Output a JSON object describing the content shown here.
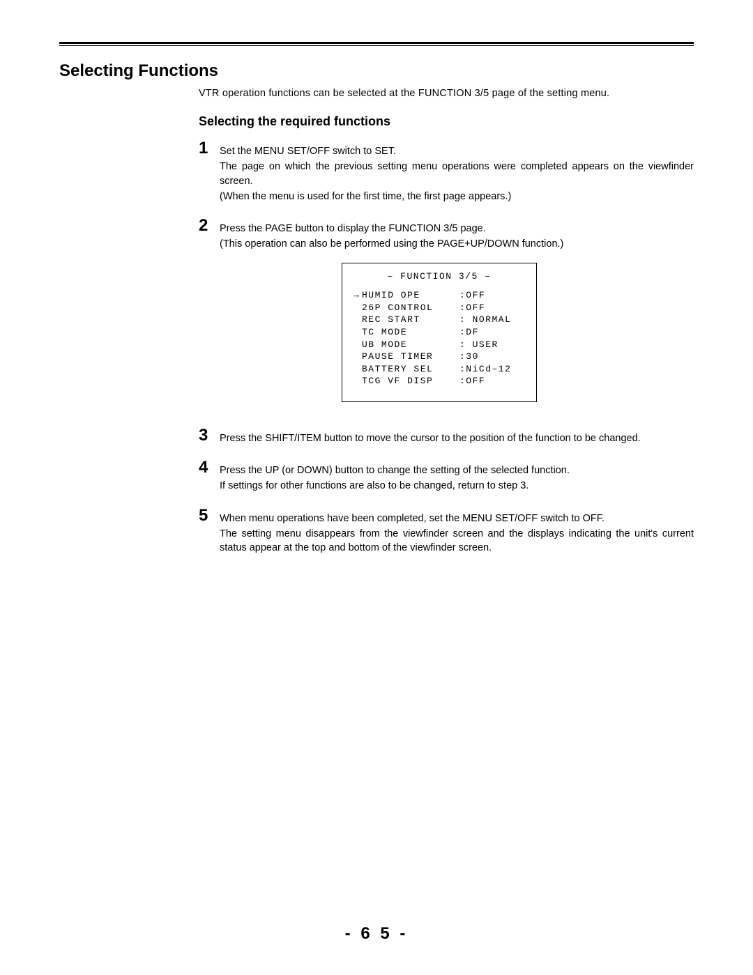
{
  "title": "Selecting Functions",
  "intro": "VTR operation functions can be selected at the FUNCTION 3/5 page of the setting menu.",
  "subheading": "Selecting the required functions",
  "steps": [
    {
      "num": "1",
      "lines": [
        "Set the MENU SET/OFF switch to SET.",
        "The page on which the previous setting menu operations were completed appears on the viewfinder screen.",
        "(When the menu is used for the first time, the first page appears.)"
      ]
    },
    {
      "num": "2",
      "lines": [
        "Press the PAGE button to display the FUNCTION 3/5 page.",
        "(This operation can also be performed using the PAGE+UP/DOWN function.)"
      ]
    },
    {
      "num": "3",
      "lines": [
        "Press the SHIFT/ITEM button to move the cursor to the position of the function to be changed."
      ]
    },
    {
      "num": "4",
      "lines": [
        "Press the UP (or DOWN) button to change the setting of the selected function.",
        "If settings for other functions are also to be changed, return to step 3."
      ]
    },
    {
      "num": "5",
      "lines": [
        "When menu operations have been completed, set the MENU SET/OFF switch to OFF.",
        "The setting menu disappears from the viewfinder screen and the displays indicating the unit's current status appear at the top and bottom of the viewfinder screen."
      ]
    }
  ],
  "menu": {
    "title": "– FUNCTION 3/5 –",
    "rows": [
      {
        "arrow": "→",
        "label": "HUMID OPE",
        "value": ":OFF"
      },
      {
        "arrow": " ",
        "label": "26P CONTROL",
        "value": ":OFF"
      },
      {
        "arrow": " ",
        "label": "REC START",
        "value": ": NORMAL"
      },
      {
        "arrow": " ",
        "label": "TC MODE",
        "value": ":DF"
      },
      {
        "arrow": " ",
        "label": "UB MODE",
        "value": ": USER"
      },
      {
        "arrow": " ",
        "label": "PAUSE TIMER",
        "value": ":30"
      },
      {
        "arrow": " ",
        "label": "BATTERY SEL",
        "value": ":NiCd–12"
      },
      {
        "arrow": " ",
        "label": "TCG VF DISP",
        "value": ":OFF"
      }
    ]
  },
  "page_number": "- 6 5 -"
}
